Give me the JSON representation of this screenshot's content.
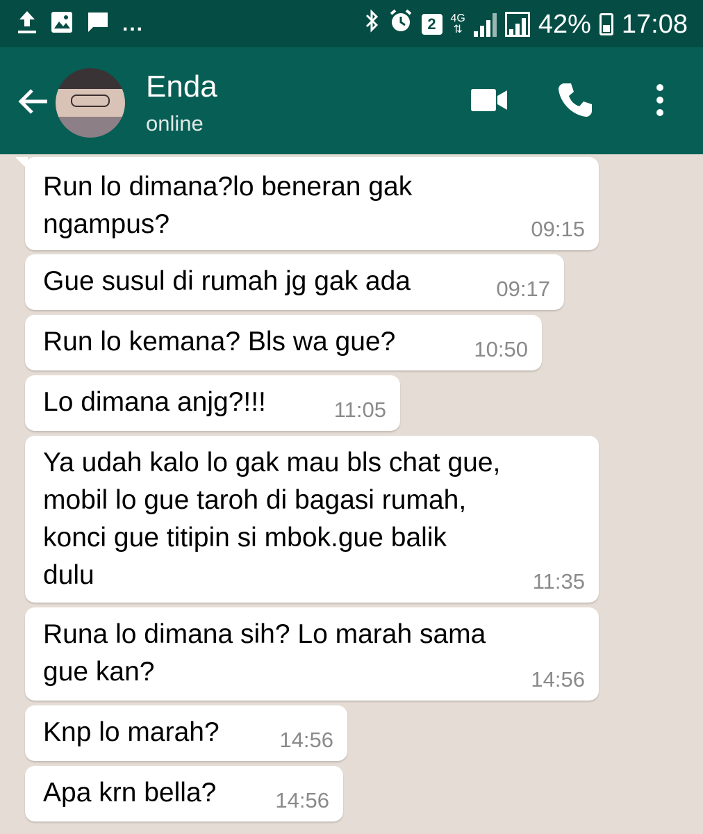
{
  "statusbar": {
    "left_icons": [
      "upload-icon",
      "image-icon",
      "message-icon"
    ],
    "more": "...",
    "sim_badge": "2",
    "network": "4G",
    "battery_pct": "42%",
    "time": "17:08"
  },
  "header": {
    "contact_name": "Enda",
    "contact_status": "online",
    "colors": {
      "bar": "#075e54",
      "status_bar": "#054d44"
    }
  },
  "messages": [
    {
      "text": "Run lo dimana?lo beneran gak\nngampus?",
      "time": "09:15"
    },
    {
      "text": "Gue susul di rumah jg gak ada",
      "time": "09:17"
    },
    {
      "text": "Run lo kemana? Bls wa gue?",
      "time": "10:50"
    },
    {
      "text": "Lo dimana anjg?!!!",
      "time": "11:05"
    },
    {
      "text": "Ya udah kalo lo gak mau bls chat gue,\nmobil lo gue taroh di bagasi rumah,\nkonci gue titipin si mbok.gue balik\ndulu",
      "time": "11:35"
    },
    {
      "text": "Runa lo dimana sih? Lo marah sama\ngue kan?",
      "time": "14:56"
    },
    {
      "text": "Knp lo marah?",
      "time": "14:56"
    },
    {
      "text": "Apa krn bella?",
      "time": "14:56"
    }
  ]
}
